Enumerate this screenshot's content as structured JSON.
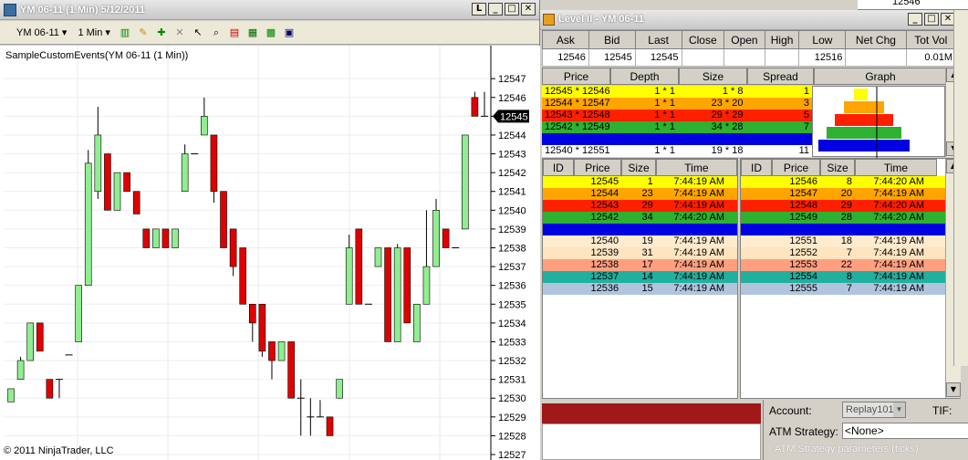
{
  "chart_window": {
    "title": "YM 06-11 (1 Min)  5/12/2011",
    "instrument_select": "YM 06-11",
    "interval_select": "1 Min",
    "indicator_label": "SampleCustomEvents(YM 06-11 (1 Min))",
    "copyright": "© 2011 NinjaTrader, LLC",
    "current_price_marker": "12545"
  },
  "chart_data": {
    "type": "candlestick",
    "y_ticks": [
      "12547",
      "12546",
      "12545",
      "12544",
      "12543",
      "12542",
      "12541",
      "12540",
      "12539",
      "12538",
      "12537",
      "12536",
      "12535",
      "12534",
      "12533",
      "12532",
      "12531",
      "12530",
      "12529",
      "12528",
      "12527"
    ],
    "ylim": [
      12527,
      12547.3
    ],
    "colors": {
      "up": "#90ee90",
      "down": "#e00000"
    },
    "candles": [
      {
        "o": 12529.8,
        "h": 12530.5,
        "l": 12529.8,
        "c": 12530.5
      },
      {
        "o": 12531,
        "h": 12532.2,
        "l": 12531,
        "c": 12532
      },
      {
        "o": 12532,
        "h": 12534,
        "l": 12532,
        "c": 12534
      },
      {
        "o": 12534,
        "h": 12534,
        "l": 12532.5,
        "c": 12532.5
      },
      {
        "o": 12531,
        "h": 12531,
        "l": 12530,
        "c": 12530
      },
      {
        "o": 12531,
        "h": 12531,
        "l": 12530,
        "c": 12531
      },
      {
        "o": 12532.3,
        "h": 12532.3,
        "l": 12532.3,
        "c": 12532.3
      },
      {
        "o": 12533,
        "h": 12536,
        "l": 12533,
        "c": 12536
      },
      {
        "o": 12536,
        "h": 12543.2,
        "l": 12536,
        "c": 12542.5
      },
      {
        "o": 12541,
        "h": 12545.5,
        "l": 12540.6,
        "c": 12544
      },
      {
        "o": 12543,
        "h": 12543,
        "l": 12540,
        "c": 12540
      },
      {
        "o": 12540,
        "h": 12542,
        "l": 12540,
        "c": 12542
      },
      {
        "o": 12542,
        "h": 12542,
        "l": 12541,
        "c": 12541
      },
      {
        "o": 12541,
        "h": 12541,
        "l": 12539.8,
        "c": 12539.8
      },
      {
        "o": 12539,
        "h": 12539,
        "l": 12538,
        "c": 12538
      },
      {
        "o": 12538,
        "h": 12539,
        "l": 12538,
        "c": 12539
      },
      {
        "o": 12539,
        "h": 12539,
        "l": 12538,
        "c": 12538
      },
      {
        "o": 12538,
        "h": 12539,
        "l": 12538,
        "c": 12539
      },
      {
        "o": 12541,
        "h": 12543.5,
        "l": 12541,
        "c": 12543
      },
      {
        "o": 12543,
        "h": 12543,
        "l": 12543,
        "c": 12543
      },
      {
        "o": 12544,
        "h": 12546,
        "l": 12544,
        "c": 12545
      },
      {
        "o": 12544,
        "h": 12544,
        "l": 12540.4,
        "c": 12541
      },
      {
        "o": 12541,
        "h": 12541,
        "l": 12538,
        "c": 12538
      },
      {
        "o": 12539,
        "h": 12539,
        "l": 12536.5,
        "c": 12537
      },
      {
        "o": 12538,
        "h": 12538,
        "l": 12535,
        "c": 12535
      },
      {
        "o": 12535,
        "h": 12535,
        "l": 12533,
        "c": 12534
      },
      {
        "o": 12535,
        "h": 12535,
        "l": 12532.2,
        "c": 12532.5
      },
      {
        "o": 12533,
        "h": 12533,
        "l": 12531,
        "c": 12532
      },
      {
        "o": 12532,
        "h": 12533,
        "l": 12532,
        "c": 12533
      },
      {
        "o": 12533,
        "h": 12533,
        "l": 12530,
        "c": 12530
      },
      {
        "o": 12530,
        "h": 12531,
        "l": 12528,
        "c": 12530
      },
      {
        "o": 12529,
        "h": 12530,
        "l": 12528,
        "c": 12529
      },
      {
        "o": 12529,
        "h": 12529.9,
        "l": 12529,
        "c": 12529
      },
      {
        "o": 12529,
        "h": 12529,
        "l": 12528,
        "c": 12528
      },
      {
        "o": 12530,
        "h": 12531,
        "l": 12530,
        "c": 12531
      },
      {
        "o": 12535,
        "h": 12538.7,
        "l": 12535,
        "c": 12538
      },
      {
        "o": 12539,
        "h": 12539,
        "l": 12535,
        "c": 12535
      },
      {
        "o": 12535,
        "h": 12535,
        "l": 12535,
        "c": 12535
      },
      {
        "o": 12537,
        "h": 12538,
        "l": 12537,
        "c": 12538
      },
      {
        "o": 12538,
        "h": 12538,
        "l": 12533,
        "c": 12533
      },
      {
        "o": 12533,
        "h": 12538.2,
        "l": 12533,
        "c": 12538
      },
      {
        "o": 12538,
        "h": 12538,
        "l": 12534,
        "c": 12534
      },
      {
        "o": 12533,
        "h": 12535,
        "l": 12533,
        "c": 12535
      },
      {
        "o": 12535,
        "h": 12540,
        "l": 12535,
        "c": 12537
      },
      {
        "o": 12537,
        "h": 12540.6,
        "l": 12537,
        "c": 12540
      },
      {
        "o": 12539,
        "h": 12539,
        "l": 12538,
        "c": 12538
      },
      {
        "o": 12538,
        "h": 12538,
        "l": 12538,
        "c": 12538
      },
      {
        "o": 12539,
        "h": 12544,
        "l": 12539,
        "c": 12544
      },
      {
        "o": 12546,
        "h": 12546.3,
        "l": 12545,
        "c": 12545
      },
      {
        "o": 12545,
        "h": 12546.3,
        "l": 12545,
        "c": 12545
      }
    ]
  },
  "level2": {
    "title": "Level II - YM 06-11",
    "summary_headers": [
      "Ask",
      "Bid",
      "Last",
      "Close",
      "Open",
      "High",
      "Low",
      "Net Chg",
      "Tot Vol"
    ],
    "summary_values": [
      "12546",
      "12545",
      "12545",
      "",
      "",
      "",
      "12516",
      "",
      "0.01M"
    ],
    "book_headers": [
      "Price",
      "Depth",
      "Size",
      "Spread",
      "Graph"
    ],
    "book_rows": [
      {
        "price": "12545 * 12546",
        "depth": "1 * 1",
        "size": "1 * 8",
        "spread": "1",
        "color": "#ffff00",
        "fg": "#000"
      },
      {
        "price": "12544 * 12547",
        "depth": "1 * 1",
        "size": "23 * 20",
        "spread": "3",
        "color": "#ffa500",
        "fg": "#000"
      },
      {
        "price": "12543 * 12548",
        "depth": "1 * 1",
        "size": "29 * 29",
        "spread": "5",
        "color": "#ff2000",
        "fg": "#000"
      },
      {
        "price": "12542 * 12549",
        "depth": "1 * 1",
        "size": "34 * 28",
        "spread": "7",
        "color": "#30b030",
        "fg": "#000"
      },
      {
        "price": "",
        "depth": "",
        "size": "",
        "spread": "",
        "color": "#0000e0",
        "fg": "#000"
      },
      {
        "price": "12540 * 12551",
        "depth": "1 * 1",
        "size": "19 * 18",
        "spread": "11",
        "color": "#ffffff",
        "fg": "#000"
      }
    ],
    "graph_bars": [
      {
        "left": 0.39,
        "right": 0.54,
        "color": "#ffff00"
      },
      {
        "left": 0.28,
        "right": 0.72,
        "color": "#ffa500"
      },
      {
        "left": 0.18,
        "right": 0.82,
        "color": "#ff2000"
      },
      {
        "left": 0.09,
        "right": 0.91,
        "color": "#30b030"
      },
      {
        "left": 0.0,
        "right": 1.0,
        "color": "#0000e0"
      }
    ],
    "tape_headers": [
      "ID",
      "Price",
      "Size",
      "Time"
    ],
    "bid_rows": [
      {
        "price": "12545",
        "size": "1",
        "time": "7:44:19 AM",
        "color": "#ffff00"
      },
      {
        "price": "12544",
        "size": "23",
        "time": "7:44:19 AM",
        "color": "#ffa500"
      },
      {
        "price": "12543",
        "size": "29",
        "time": "7:44:19 AM",
        "color": "#ff2000"
      },
      {
        "price": "12542",
        "size": "34",
        "time": "7:44:20 AM",
        "color": "#30b030"
      },
      {
        "price": "",
        "size": "",
        "time": "",
        "color": "#0000e0"
      },
      {
        "price": "12540",
        "size": "19",
        "time": "7:44:19 AM",
        "color": "#ffecd0"
      },
      {
        "price": "12539",
        "size": "31",
        "time": "7:44:19 AM",
        "color": "#ffe4c0"
      },
      {
        "price": "12538",
        "size": "17",
        "time": "7:44:19 AM",
        "color": "#ff9f80"
      },
      {
        "price": "12537",
        "size": "14",
        "time": "7:44:19 AM",
        "color": "#20b0a0"
      },
      {
        "price": "12536",
        "size": "15",
        "time": "7:44:19 AM",
        "color": "#b0c4de"
      }
    ],
    "ask_rows": [
      {
        "price": "12546",
        "size": "8",
        "time": "7:44:20 AM",
        "color": "#ffff00"
      },
      {
        "price": "12547",
        "size": "20",
        "time": "7:44:19 AM",
        "color": "#ffa500"
      },
      {
        "price": "12548",
        "size": "29",
        "time": "7:44:20 AM",
        "color": "#ff2000"
      },
      {
        "price": "12549",
        "size": "28",
        "time": "7:44:20 AM",
        "color": "#30b030"
      },
      {
        "price": "",
        "size": "",
        "time": "",
        "color": "#0000e0"
      },
      {
        "price": "12551",
        "size": "18",
        "time": "7:44:19 AM",
        "color": "#ffecd0"
      },
      {
        "price": "12552",
        "size": "7",
        "time": "7:44:19 AM",
        "color": "#ffe4c0"
      },
      {
        "price": "12553",
        "size": "22",
        "time": "7:44:19 AM",
        "color": "#ff9f80"
      },
      {
        "price": "12554",
        "size": "8",
        "time": "7:44:19 AM",
        "color": "#20b0a0"
      },
      {
        "price": "12555",
        "size": "7",
        "time": "7:44:19 AM",
        "color": "#b0c4de"
      }
    ]
  },
  "order_panel": {
    "account_label": "Account:",
    "account_value": "Replay101",
    "tif_label": "TIF:",
    "atm_label": "ATM Strategy:",
    "atm_value": "<None>",
    "atm_params_label": "ATM Strategy parameters (ticks)",
    "top_right_value": "12546"
  }
}
